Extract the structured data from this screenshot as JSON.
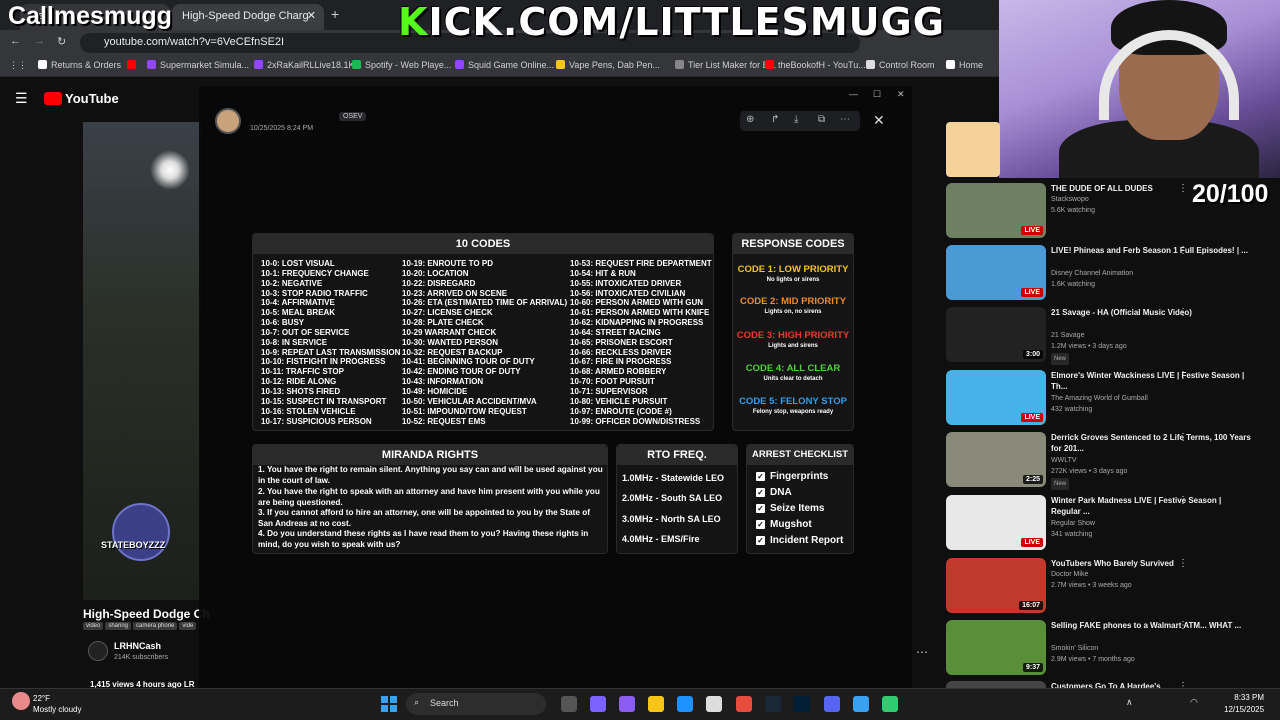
{
  "browser": {
    "tabs": [
      {
        "label": "Ca"
      },
      {
        "label": "High-Speed Dodge Charg"
      }
    ],
    "new_tab": "+",
    "url": "youtube.com/watch?v=6VeCEfnSE2I",
    "bookmarks": [
      {
        "label": "Returns & Orders",
        "color": "#ffffff"
      },
      {
        "label": "",
        "color": "#ff0000"
      },
      {
        "label": "Supermarket Simula...",
        "color": "#9146ff"
      },
      {
        "label": "2xRaKailRLLive18.1K...",
        "color": "#9146ff"
      },
      {
        "label": "Spotify - Web Playe...",
        "color": "#1db954"
      },
      {
        "label": "Squid Game Online...",
        "color": "#9146ff"
      },
      {
        "label": "Vape Pens, Dab Pen...",
        "color": "#f5c518"
      },
      {
        "label": "Tier List Maker for E...",
        "color": "#888888"
      },
      {
        "label": "theBookofH - YouTu...",
        "color": "#ff0000"
      },
      {
        "label": "Control Room",
        "color": "#dddddd"
      },
      {
        "label": "Home",
        "color": "#ffffff"
      }
    ]
  },
  "overlay": {
    "streamer": "Callmesmugg",
    "kick_prefix": "K",
    "kick_rest": "ICK.COM/LITTLESMUGG",
    "counter": "20/100"
  },
  "youtube": {
    "logo": "YouTube",
    "video_title": "High-Speed Dodge Ch",
    "tags": [
      "video",
      "sharing",
      "camera phone",
      "vide"
    ],
    "channel": "LRHNCash",
    "subscribers": "214K subscribers",
    "views": "1,415 views  4 hours ago  LR",
    "watermark": "STATEBOYZZZ",
    "recommendations": [
      {
        "title": "THE DUDE OF ALL DUDES",
        "channel": "Stackswopo",
        "meta": "5.6K watching",
        "badge": "LIVE",
        "new": "",
        "thumb": "#6f7f62"
      },
      {
        "title": "LIVE! Phineas and Ferb Season 1 Full Episodes! | ...",
        "channel": "Disney Channel Animation",
        "meta": "1.6K watching",
        "badge": "LIVE",
        "new": "",
        "thumb": "#4a9ad6"
      },
      {
        "title": "21 Savage - HA (Official Music Video)",
        "channel": "21 Savage",
        "meta": "1.2M views • 3 days ago",
        "badge": "3:00",
        "new": "New",
        "thumb": "#222222"
      },
      {
        "title": "Elmore's Winter Wackiness LIVE | Festive Season | Th...",
        "channel": "The Amazing World of Gumball",
        "meta": "432 watching",
        "badge": "LIVE",
        "new": "",
        "thumb": "#45b3e8"
      },
      {
        "title": "Derrick Groves Sentenced to 2 Life Terms, 100 Years for 201...",
        "channel": "WWLTV",
        "meta": "272K views • 3 days ago",
        "badge": "2:25",
        "new": "New",
        "thumb": "#8a8a7a"
      },
      {
        "title": "Winter Park Madness LIVE | Festive Season | Regular ...",
        "channel": "Regular Show",
        "meta": "341 watching",
        "badge": "LIVE",
        "new": "",
        "thumb": "#e8e8e8"
      },
      {
        "title": "YouTubers Who Barely Survived",
        "channel": "Doctor Mike",
        "meta": "2.7M views • 3 weeks ago",
        "badge": "16:07",
        "new": "",
        "thumb": "#c0392b"
      },
      {
        "title": "Selling FAKE phones to a Walmart ATM... WHAT ...",
        "channel": "Smokin' Silicon",
        "meta": "2.9M views • 7 months ago",
        "badge": "9:37",
        "new": "",
        "thumb": "#5a8f3a"
      },
      {
        "title": "Customers Go To A Hardee's",
        "channel": "",
        "meta": "",
        "badge": "",
        "new": "",
        "thumb": "#444444"
      }
    ]
  },
  "viewer": {
    "username": "OSEV",
    "date": "10/25/2025 8:24 PM"
  },
  "ten_codes": {
    "title": "10 CODES",
    "col1": [
      "10-0: LOST VISUAL",
      "10-1: FREQUENCY CHANGE",
      "10-2: NEGATIVE",
      "10-3: STOP RADIO TRAFFIC",
      "10-4: AFFIRMATIVE",
      "10-5: MEAL BREAK",
      "10-6: BUSY",
      "10-7: OUT OF SERVICE",
      "10-8: IN SERVICE",
      "10-9: REPEAT LAST TRANSMISSION",
      "10-10: FISTFIGHT IN PROGRESS",
      "10-11: TRAFFIC STOP",
      "10-12: RIDE ALONG",
      "10-13: SHOTS FIRED",
      "10-15: SUSPECT IN TRANSPORT",
      "10-16: STOLEN VEHICLE",
      "10-17: SUSPICIOUS PERSON"
    ],
    "col2": [
      "10-19: ENROUTE TO PD",
      "10-20: LOCATION",
      "10-22: DISREGARD",
      "10-23: ARRIVED ON SCENE",
      "10-26: ETA (ESTIMATED TIME OF ARRIVAL)",
      "10-27: LICENSE CHECK",
      "10-28: PLATE CHECK",
      "10-29 WARRANT CHECK",
      "10-30: WANTED PERSON",
      "10-32: REQUEST BACKUP",
      "10-41: BEGINNING TOUR OF DUTY",
      "10-42: ENDING TOUR OF DUTY",
      "10-43: INFORMATION",
      "10-49: HOMICIDE",
      "10-50: VEHICULAR ACCIDENT/MVA",
      "10-51: IMPOUND/TOW REQUEST",
      "10-52: REQUEST EMS"
    ],
    "col3": [
      "10-53: REQUEST FIRE DEPARTMENT",
      "10-54: HIT & RUN",
      "10-55: INTOXICATED DRIVER",
      "10-56: INTOXICATED CIVILIAN",
      "10-60: PERSON ARMED WITH GUN",
      "10-61: PERSON ARMED WITH KNIFE",
      "10-62: KIDNAPPING IN PROGRESS",
      "10-64: STREET RACING",
      "10-65: PRISONER ESCORT",
      "10-66: RECKLESS DRIVER",
      "10-67: FIRE IN PROGRESS",
      "10-68: ARMED ROBBERY",
      "10-70: FOOT PURSUIT",
      "10-71: SUPERVISOR",
      "10-80: VEHICLE PURSUIT",
      "10-97: ENROUTE (CODE #)",
      "10-99: OFFICER DOWN/DISTRESS"
    ]
  },
  "response_codes": {
    "title": "RESPONSE CODES",
    "items": [
      {
        "label": "CODE 1: LOW PRIORITY",
        "sub": "No lights or sirens",
        "color": "#f5c518"
      },
      {
        "label": "CODE 2: MID PRIORITY",
        "sub": "Lights on, no sirens",
        "color": "#f08a24"
      },
      {
        "label": "CODE 3: HIGH PRIORITY",
        "sub": "Lights and sirens",
        "color": "#e63b2e"
      },
      {
        "label": "CODE 4: ALL CLEAR",
        "sub": "Units clear to detach",
        "color": "#4cd137"
      },
      {
        "label": "CODE 5: FELONY STOP",
        "sub": "Felony stop, weapons ready",
        "color": "#2e9ef0"
      }
    ]
  },
  "miranda": {
    "title": "MIRANDA RIGHTS",
    "items": [
      "1.  You have the right to remain silent. Anything you say can and will be used against you in the court of law.",
      "2. You have the right to speak with an attorney and have him present with you while you are being questioned.",
      "3. If you cannot afford to hire an attorney, one will be appointed to you by the State of San Andreas at no cost.",
      "4. Do you understand these rights as I have read them to you? Having these rights in mind, do you wish to speak with us?"
    ]
  },
  "rto": {
    "title": "RTO FREQ.",
    "items": [
      "1.0MHz - Statewide LEO",
      "2.0MHz - South SA LEO",
      "3.0MHz - North SA LEO",
      "4.0MHz - EMS/Fire"
    ]
  },
  "arrest": {
    "title": "ARREST CHECKLIST",
    "check": "✓",
    "items": [
      "Fingerprints",
      "DNA",
      "Seize Items",
      "Mugshot",
      "Incident Report"
    ]
  },
  "taskbar": {
    "temp": "22°F",
    "weather": "Mostly cloudy",
    "search": "Search",
    "time": "8:33 PM",
    "date": "12/15/2025"
  }
}
